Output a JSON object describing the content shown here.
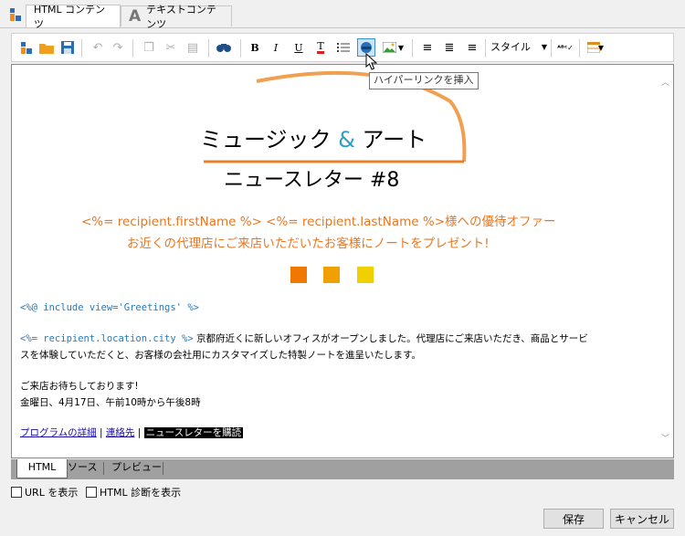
{
  "tabs": [
    {
      "label": "HTML コンテンツ",
      "icon": "html-app-icon"
    },
    {
      "label": "テキストコンテンツ",
      "icon": "text-a-icon"
    }
  ],
  "toolbar": {
    "style_label": "スタイル",
    "tooltip": "ハイパーリンクを挿入"
  },
  "doc": {
    "title_line1_a": "ミュージック",
    "title_amp": "&",
    "title_line1_b": "アート",
    "title_line2": "ニュースレター #8",
    "offer_line1": "<%= recipient.firstName %> <%= recipient.lastName %>様への優待オファー",
    "offer_line2": "お近くの代理店にご来店いただいたお客様にノートをプレゼント!",
    "include_code": "<%@ include view='Greetings' %>",
    "city_code": "<%= recipient.location.city %>",
    "para1_rest": "京都府近くに新しいオフィスがオープンしました。代理店にご来店いただき、商品とサービ",
    "para1_line2": "スを体験していただくと、お客様の会社用にカスタマイズした特製ノートを進呈いたします。",
    "wait": "ご来店お待ちしております!",
    "hours": "金曜日、4月17日、午前10時から午後8時",
    "link1": "プログラムの詳細",
    "link2": "連絡先",
    "link3": "ニュースレターを購読",
    "pipe": "|",
    "colors": [
      "#f07800",
      "#f0a000",
      "#f0d000"
    ]
  },
  "bottom_tabs": [
    "HTML",
    "ソース",
    "プレビュー"
  ],
  "options": {
    "show_url": "URL を表示",
    "html_diag": "HTML 診断を表示"
  },
  "buttons": {
    "save": "保存",
    "cancel": "キャンセル"
  }
}
